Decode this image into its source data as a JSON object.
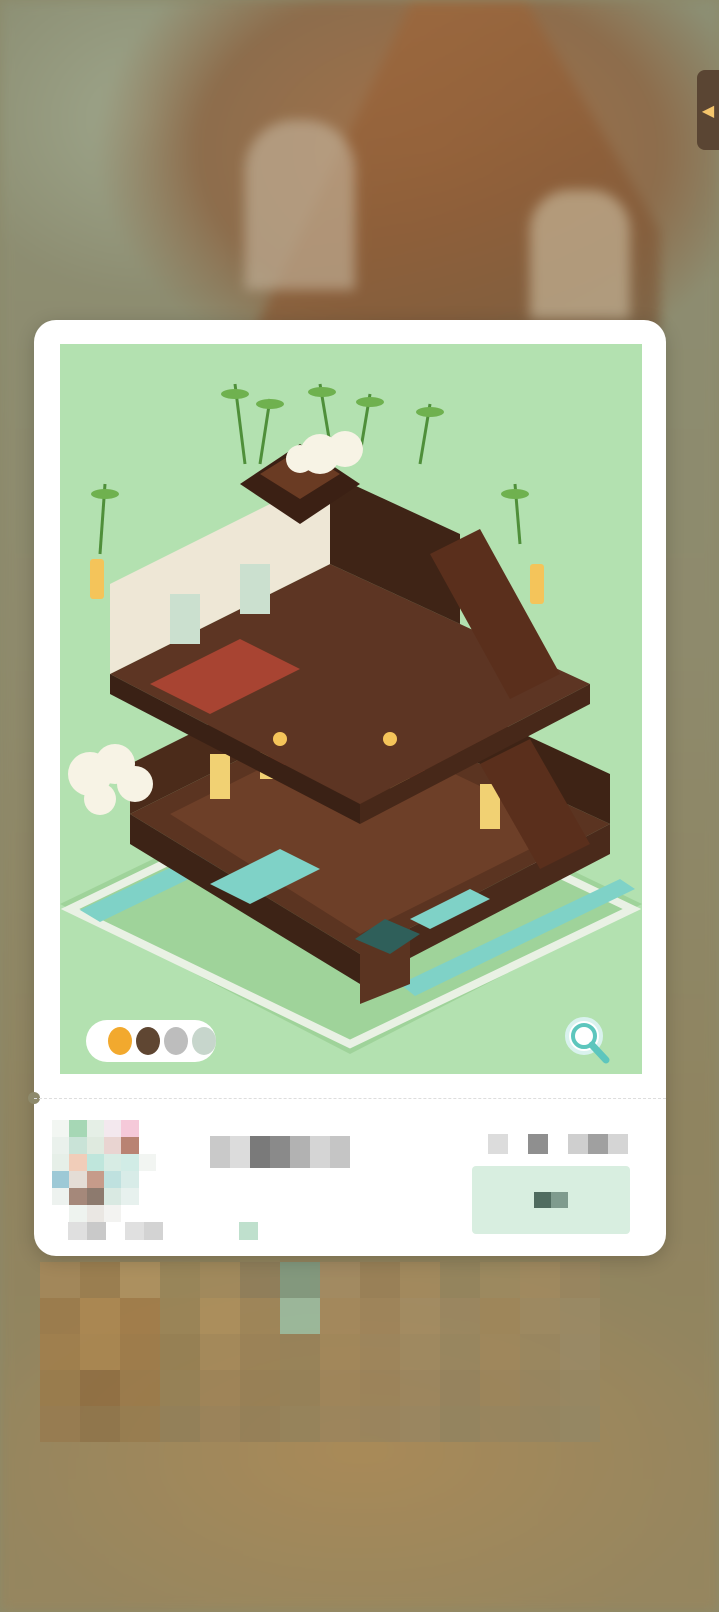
{
  "screen": {
    "side_tab_icon": "chevron-left-icon"
  },
  "card": {
    "palette": {
      "swatches": [
        "#f2a92e",
        "#5f4632",
        "#bdbdbd",
        "#c7d6cc"
      ]
    },
    "zoom_button_icon": "magnifier-icon",
    "colors": {
      "artwork_background": "#b3e1b0",
      "accent": "#5dc6bd"
    }
  }
}
